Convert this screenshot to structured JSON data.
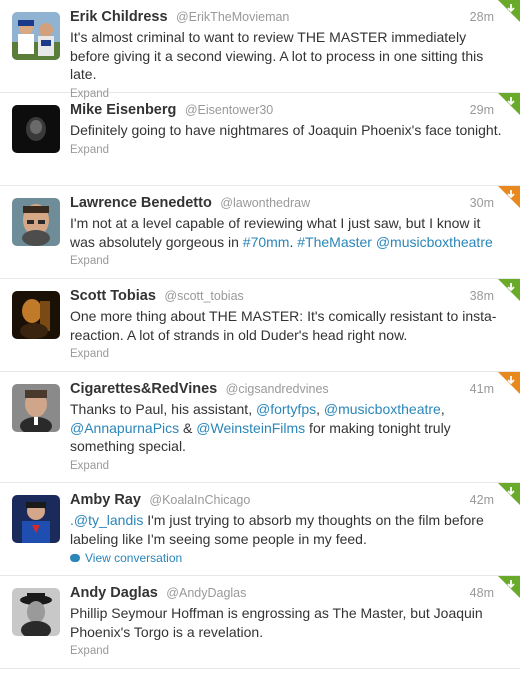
{
  "tweets": [
    {
      "name": "Erik Childress",
      "username": "@ErikTheMovieman",
      "time": "28m",
      "text": "It's almost criminal to want to review THE MASTER immediately before giving it a second viewing. A lot to process in one sitting this late.",
      "action": "Expand",
      "corner_color": "#6aaa2a"
    },
    {
      "name": "Mike Eisenberg",
      "username": "@Eisentower30",
      "time": "29m",
      "text": "Definitely going to have nightmares of Joaquin Phoenix's face tonight.",
      "action": "Expand",
      "corner_color": "#6aaa2a"
    },
    {
      "name": "Lawrence Benedetto",
      "username": "@lawonthedraw",
      "time": "30m",
      "text_parts": {
        "a": "I'm not at a level capable of reviewing what I just saw, but I know it was absolutely gorgeous in ",
        "h1": "#70mm",
        "b": ". ",
        "h2": "#TheMaster",
        "c": " ",
        "m1": "@musicboxtheatre"
      },
      "action": "Expand",
      "corner_color": "#e8891f"
    },
    {
      "name": "Scott Tobias",
      "username": "@scott_tobias",
      "time": "38m",
      "text": "One more thing about THE MASTER: It's comically resistant to insta-reaction. A lot of strands in old Duder's head right now.",
      "action": "Expand",
      "corner_color": "#6aaa2a"
    },
    {
      "name": "Cigarettes&RedVines",
      "username": "@cigsandredvines",
      "time": "41m",
      "text_parts": {
        "a": "Thanks to Paul, his assistant, ",
        "m1": "@fortyfps",
        "b": ", ",
        "m2": "@musicboxtheatre",
        "c": ", ",
        "m3": "@AnnapurnaPics",
        "d": " & ",
        "m4": "@WeinsteinFilms",
        "e": " for making tonight truly something special."
      },
      "action": "Expand",
      "corner_color": "#e8891f"
    },
    {
      "name": "Amby Ray",
      "username": "@KoalaInChicago",
      "time": "42m",
      "text_parts": {
        "m1": ".@ty_landis",
        "a": " I'm just trying to absorb my thoughts on the film before labeling like I'm seeing some people in my feed."
      },
      "action": "View conversation",
      "corner_color": "#6aaa2a"
    },
    {
      "name": "Andy Daglas",
      "username": "@AndyDaglas",
      "time": "48m",
      "text": "Phillip Seymour Hoffman is engrossing as The Master, but Joaquin Phoenix's Torgo is a revelation.",
      "action": "Expand",
      "corner_color": "#6aaa2a"
    }
  ]
}
